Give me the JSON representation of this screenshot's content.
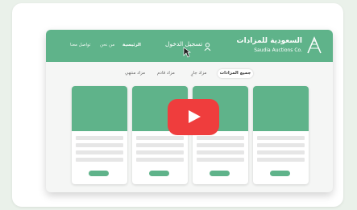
{
  "header": {
    "logo_ar": "السعودية للمزادات",
    "logo_en": "Saudia Auctions Co.",
    "login_label": "تسجيل الدخول",
    "nav": [
      {
        "label": "الرئيسية"
      },
      {
        "label": "من نحن"
      },
      {
        "label": "تواصل معنا"
      }
    ]
  },
  "filters": [
    {
      "label": "جميع المزادات",
      "active": true
    },
    {
      "label": "مزاد جارٍ",
      "active": false
    },
    {
      "label": "مزاد قادم",
      "active": false
    },
    {
      "label": "مزاد منتهي",
      "active": false
    }
  ],
  "video": {
    "play_icon": "play-icon",
    "accent": "#ef3d3d"
  },
  "colors": {
    "brand": "#5fb38a"
  }
}
